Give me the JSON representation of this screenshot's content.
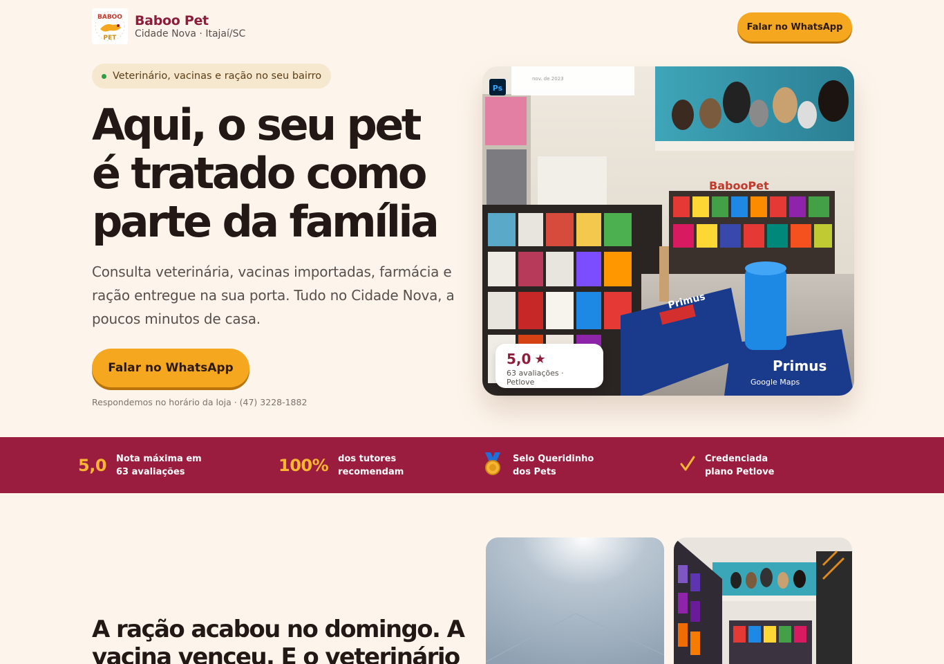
{
  "header": {
    "brand_name": "Baboo Pet",
    "brand_location": "Cidade Nova · Itajaí/SC",
    "cta_label": "Falar no WhatsApp"
  },
  "hero": {
    "badge": "Veterinário, vacinas e ração no seu bairro",
    "title_lines": [
      "Aqui, o seu pet",
      "é tratado como",
      "parte da família"
    ],
    "description": "Consulta veterinária, vacinas importadas, farmácia e ração entregue na sua porta. Tudo no Cidade Nova, a poucos minutos de casa.",
    "cta_label": "Falar no WhatsApp",
    "note": "Respondemos no horário da loja · (47) 3228-1882",
    "rating": {
      "value": "5,0",
      "star": "★",
      "caption": "63 avaliações · Petlove"
    }
  },
  "stats": [
    {
      "big": "5,0",
      "line1": "Nota máxima em",
      "line2": "63 avaliações",
      "icon": null
    },
    {
      "big": "100%",
      "line1": "dos tutores",
      "line2": "recomendam",
      "icon": null
    },
    {
      "big": null,
      "line1": "Selo Queridinho",
      "line2": "dos Pets",
      "icon": "medal-icon"
    },
    {
      "big": null,
      "line1": "Credenciada",
      "line2": "plano Petlove",
      "icon": "check-icon"
    }
  ],
  "section2": {
    "title_lines": [
      "A ração acabou no domingo. A",
      "vacina venceu. E o veterinário"
    ]
  },
  "colors": {
    "background": "#fdf5ec",
    "brand_red": "#8e1c3b",
    "band_red": "#9a1c3f",
    "accent_yellow": "#f5a81f",
    "text_dark": "#231815"
  }
}
